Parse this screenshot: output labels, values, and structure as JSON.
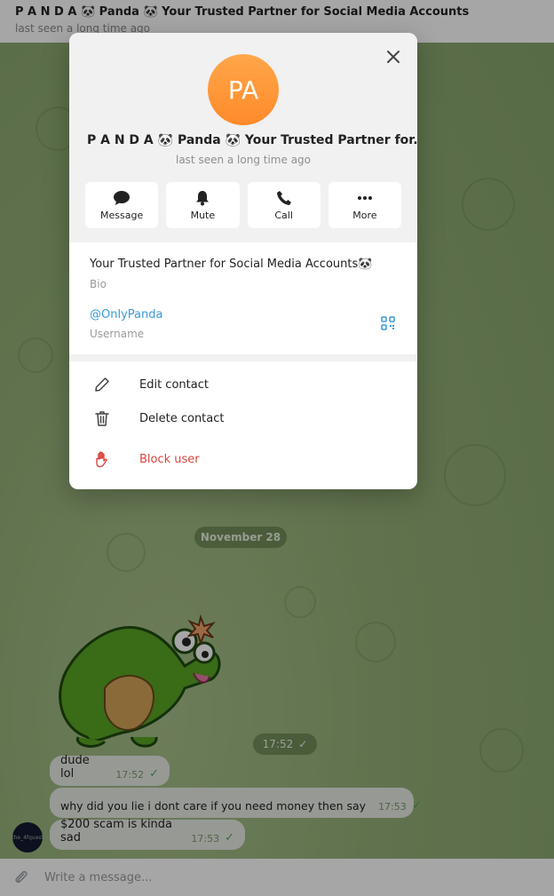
{
  "chat": {
    "title": "P A N D A 🐼 Panda 🐼 Your Trusted Partner for Social Media Accounts",
    "status": "last seen a long time ago",
    "date_chip": "November 28",
    "sticker_time": "17:52",
    "messages": [
      {
        "text": "dude lol",
        "time": "17:52"
      },
      {
        "text": "why did you lie i dont care if you need money then say",
        "time": "17:53"
      },
      {
        "text": "$200 scam is kinda sad",
        "time": "17:53"
      }
    ],
    "sender_avatar_text": "the_4fquest",
    "composer_placeholder": "Write a message..."
  },
  "profile": {
    "avatar_initials": "PA",
    "name": "P A N D A 🐼 Panda 🐼 Your Trusted Partner for...",
    "status": "last seen a long time ago",
    "actions": [
      {
        "label": "Message",
        "icon": "chat-bubble-icon"
      },
      {
        "label": "Mute",
        "icon": "bell-icon"
      },
      {
        "label": "Call",
        "icon": "phone-icon"
      },
      {
        "label": "More",
        "icon": "more-dots-icon"
      }
    ],
    "bio": "Your Trusted Partner for Social Media Accounts🐼",
    "bio_label": "Bio",
    "username": "@OnlyPanda",
    "username_label": "Username",
    "menu": [
      {
        "label": "Edit contact",
        "icon": "pencil-icon"
      },
      {
        "label": "Delete contact",
        "icon": "trash-icon"
      },
      {
        "label": "Block user",
        "icon": "hand-stop-icon"
      }
    ]
  },
  "colors": {
    "accent": "#3a9ad9",
    "danger": "#d9453e",
    "avatar_orange": "#ff8a2a",
    "check_green": "#5aa35a"
  }
}
